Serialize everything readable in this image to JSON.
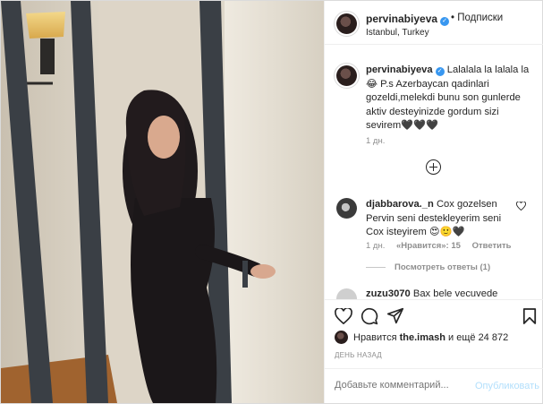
{
  "header": {
    "username": "pervinabiyeva",
    "verified_badge": "✓",
    "separator": "•",
    "follow_label": "Подписки",
    "location": "Istanbul, Turkey"
  },
  "caption": {
    "username": "pervinabiyeva",
    "text": "Lalalala la lalala la😂 P.s Azerbaycan qadinlari gozeldi,melekdi bunu son gunlerde aktiv desteyinizde gordum sizi sevirem🖤🖤🖤",
    "time": "1 дн."
  },
  "comments": [
    {
      "username": "djabbarova._n",
      "text": "Cox gozelsen Pervin seni destekleyerim seni Cox isteyirem 😍🙂🖤",
      "time": "1 дн.",
      "likes": "«Нравится»: 15",
      "reply_label": "Ответить",
      "view_replies": "Посмотреть ответы (1)"
    },
    {
      "username": "zuzu3070",
      "text": "Bax bele vecuvede"
    }
  ],
  "likes": {
    "text_prefix": "Нравится ",
    "liked_by": "the.imash",
    "text_suffix": " и ещё 24 872"
  },
  "post_time": "ДЕНЬ НАЗАД",
  "add_comment": {
    "placeholder": "Добавьте комментарий...",
    "publish_label": "Опубликовать"
  },
  "icons": {
    "like": "heart-icon",
    "comment": "comment-icon",
    "share": "share-icon",
    "save": "bookmark-icon",
    "add_comments": "plus-circle-icon",
    "comment_like": "heart-icon"
  },
  "colors": {
    "verified": "#3897f0",
    "publish_disabled": "#b2dffc",
    "muted": "#8e8e8e",
    "text": "#262626"
  }
}
